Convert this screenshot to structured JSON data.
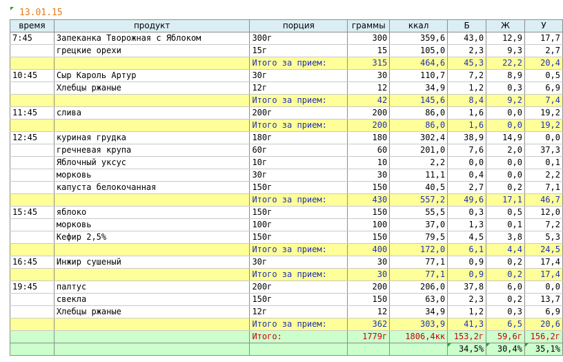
{
  "date": "13.01.15",
  "headers": {
    "time": "время",
    "product": "продукт",
    "portion": "порция",
    "grams": "граммы",
    "kcal": "ккал",
    "b": "Б",
    "zh": "Ж",
    "u": "У"
  },
  "meals": [
    {
      "time": "7:45",
      "items": [
        {
          "product": "Запеканка Творожная с Яблоком",
          "portion": "300г",
          "grams": "300",
          "kcal": "359,6",
          "b": "43,0",
          "zh": "12,9",
          "u": "17,7"
        },
        {
          "product": "грецкие орехи",
          "portion": "15г",
          "grams": "15",
          "kcal": "105,0",
          "b": "2,3",
          "zh": "9,3",
          "u": "2,7"
        }
      ],
      "total": {
        "label": "Итого за прием:",
        "grams": "315",
        "kcal": "464,6",
        "b": "45,3",
        "zh": "22,2",
        "u": "20,4"
      }
    },
    {
      "time": "10:45",
      "items": [
        {
          "product": "Сыр Кароль Артур",
          "portion": "30г",
          "grams": "30",
          "kcal": "110,7",
          "b": "7,2",
          "zh": "8,9",
          "u": "0,5"
        },
        {
          "product": "Хлебцы ржаные",
          "portion": "12г",
          "grams": "12",
          "kcal": "34,9",
          "b": "1,2",
          "zh": "0,3",
          "u": "6,9"
        }
      ],
      "total": {
        "label": "Итого за прием:",
        "grams": "42",
        "kcal": "145,6",
        "b": "8,4",
        "zh": "9,2",
        "u": "7,4"
      }
    },
    {
      "time": "11:45",
      "items": [
        {
          "product": "слива",
          "portion": "200г",
          "grams": "200",
          "kcal": "86,0",
          "b": "1,6",
          "zh": "0,0",
          "u": "19,2"
        }
      ],
      "total": {
        "label": "Итого за прием:",
        "grams": "200",
        "kcal": "86,0",
        "b": "1,6",
        "zh": "0,0",
        "u": "19,2"
      }
    },
    {
      "time": "12:45",
      "items": [
        {
          "product": "куриная грудка",
          "portion": "180г",
          "grams": "180",
          "kcal": "302,4",
          "b": "38,9",
          "zh": "14,9",
          "u": "0,0"
        },
        {
          "product": "гречневая крупа",
          "portion": "60г",
          "grams": "60",
          "kcal": "201,0",
          "b": "7,6",
          "zh": "2,0",
          "u": "37,3"
        },
        {
          "product": "Яблочный уксус",
          "portion": "10г",
          "grams": "10",
          "kcal": "2,2",
          "b": "0,0",
          "zh": "0,0",
          "u": "0,1"
        },
        {
          "product": "морковь",
          "portion": "30г",
          "grams": "30",
          "kcal": "11,1",
          "b": "0,4",
          "zh": "0,0",
          "u": "2,2"
        },
        {
          "product": "капуста белокочанная",
          "portion": "150г",
          "grams": "150",
          "kcal": "40,5",
          "b": "2,7",
          "zh": "0,2",
          "u": "7,1"
        }
      ],
      "total": {
        "label": "Итого за прием:",
        "grams": "430",
        "kcal": "557,2",
        "b": "49,6",
        "zh": "17,1",
        "u": "46,7"
      }
    },
    {
      "time": "15:45",
      "items": [
        {
          "product": "яблоко",
          "portion": "150г",
          "grams": "150",
          "kcal": "55,5",
          "b": "0,3",
          "zh": "0,5",
          "u": "12,0"
        },
        {
          "product": "морковь",
          "portion": "100г",
          "grams": "100",
          "kcal": "37,0",
          "b": "1,3",
          "zh": "0,1",
          "u": "7,2"
        },
        {
          "product": "Кефир 2,5%",
          "portion": "150г",
          "grams": "150",
          "kcal": "79,5",
          "b": "4,5",
          "zh": "3,8",
          "u": "5,3"
        }
      ],
      "total": {
        "label": "Итого за прием:",
        "grams": "400",
        "kcal": "172,0",
        "b": "6,1",
        "zh": "4,4",
        "u": "24,5"
      }
    },
    {
      "time": "16:45",
      "items": [
        {
          "product": "Инжир сушеный",
          "portion": "30г",
          "grams": "30",
          "kcal": "77,1",
          "b": "0,9",
          "zh": "0,2",
          "u": "17,4"
        }
      ],
      "total": {
        "label": "Итого за прием:",
        "grams": "30",
        "kcal": "77,1",
        "b": "0,9",
        "zh": "0,2",
        "u": "17,4"
      }
    },
    {
      "time": "19:45",
      "items": [
        {
          "product": "палтус",
          "portion": "200г",
          "grams": "200",
          "kcal": "206,0",
          "b": "37,8",
          "zh": "6,0",
          "u": "0,0"
        },
        {
          "product": "свекла",
          "portion": "150г",
          "grams": "150",
          "kcal": "63,0",
          "b": "2,3",
          "zh": "0,2",
          "u": "13,7"
        },
        {
          "product": "Хлебцы ржаные",
          "portion": "12г",
          "grams": "12",
          "kcal": "34,9",
          "b": "1,2",
          "zh": "0,3",
          "u": "6,9"
        }
      ],
      "total": {
        "label": "Итого за прием:",
        "grams": "362",
        "kcal": "303,9",
        "b": "41,3",
        "zh": "6,5",
        "u": "20,6"
      }
    }
  ],
  "grand_total": {
    "label": "Итого:",
    "grams": "1779г",
    "kcal": "1806,4кк",
    "b": "153,2г",
    "zh": "59,6г",
    "u": "156,2г"
  },
  "percentages": {
    "b": "34,5%",
    "zh": "30,4%",
    "u": "35,1%"
  }
}
